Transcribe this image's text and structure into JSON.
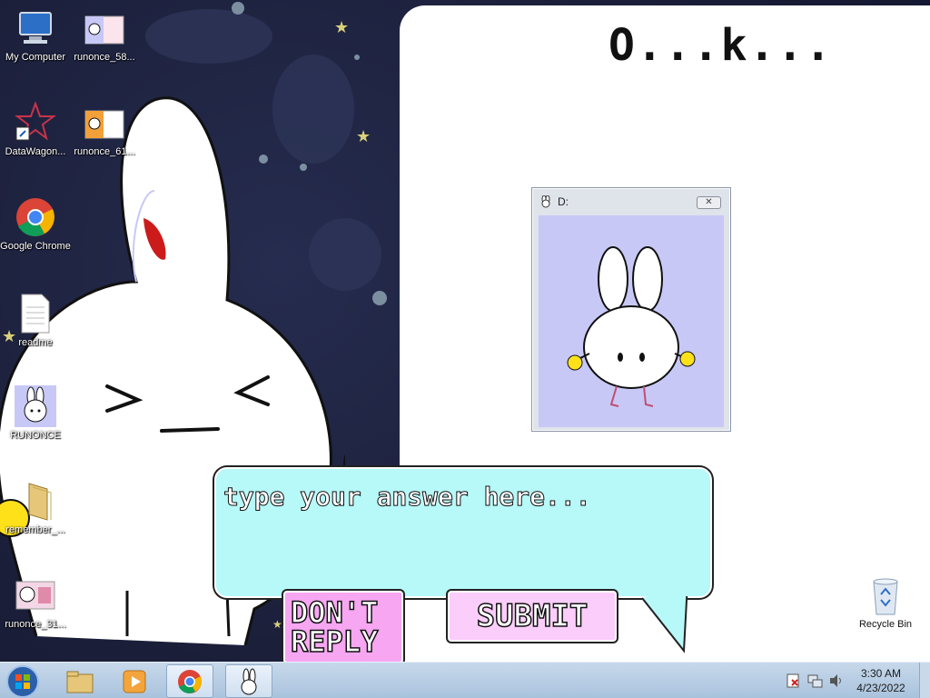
{
  "desktop": {
    "icons_left": [
      {
        "label": "My Computer",
        "icon": "computer-icon"
      },
      {
        "label": "DataWagon...",
        "icon": "datawagon-icon"
      },
      {
        "label": "Google Chrome",
        "icon": "chrome-icon"
      },
      {
        "label": "readme",
        "icon": "text-file-icon"
      },
      {
        "label": "RUNONCE",
        "icon": "bunny-app-icon"
      },
      {
        "label": "remember_...",
        "icon": "folder-icon"
      },
      {
        "label": "runonce_31...",
        "icon": "image-file-icon"
      }
    ],
    "icons_col2": [
      {
        "label": "runonce_58...",
        "icon": "image-file-icon"
      },
      {
        "label": "runonce_61...",
        "icon": "image-file-icon"
      }
    ],
    "recycle_bin": {
      "label": "Recycle Bin",
      "icon": "recycle-bin-icon"
    }
  },
  "app": {
    "heading": "O...k...",
    "popup": {
      "title": "D:",
      "close_label": "✕"
    },
    "answer": {
      "placeholder": "type your answer here...",
      "value": ""
    },
    "dont_reply_label": "DON'T REPLY",
    "submit_label": "SUBMIT"
  },
  "taskbar": {
    "items": [
      "explorer",
      "media-player",
      "chrome",
      "runonce"
    ],
    "time": "3:30 AM",
    "date": "4/23/2022"
  },
  "colors": {
    "bubble": "#b7f8f8",
    "popup_bg": "#c8c8f7",
    "dont_reply": "#f7a6f2",
    "submit": "#fbcdfa"
  }
}
